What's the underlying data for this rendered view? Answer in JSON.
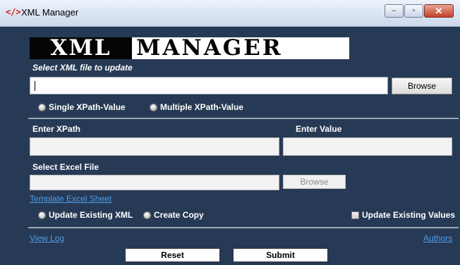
{
  "window": {
    "title": "XML Manager",
    "icon": "xml-code-icon",
    "min": "–",
    "max": "▫",
    "close": "✕"
  },
  "banner": {
    "left": "XML",
    "right": "MANAGER"
  },
  "file_section": {
    "label": "Select XML file to update",
    "path_value": "",
    "browse_label": "Browse"
  },
  "mode": {
    "single_label": "Single XPath-Value",
    "multiple_label": "Multiple XPath-Value"
  },
  "xpath": {
    "label": "Enter XPath",
    "value": ""
  },
  "value": {
    "label": "Enter Value",
    "value": ""
  },
  "excel": {
    "label": "Select Excel File",
    "value": "",
    "browse_label": "Browse",
    "template_link": "Template Excel Sheet"
  },
  "options": {
    "update_existing_xml": "Update Existing XML",
    "create_copy": "Create Copy",
    "update_existing_values": "Update Existing Values"
  },
  "footer": {
    "view_log": "View Log",
    "authors": "Authors",
    "reset": "Reset",
    "submit": "Submit"
  },
  "colors": {
    "background": "#273a55",
    "link": "#4e9ee8"
  }
}
